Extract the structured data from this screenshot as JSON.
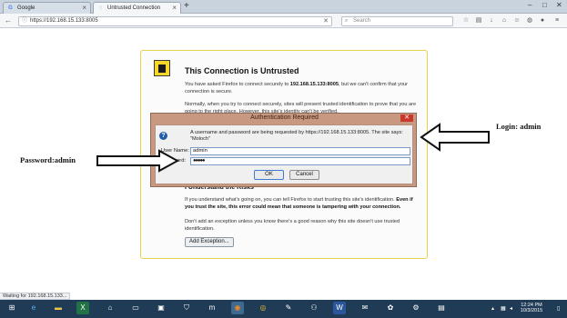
{
  "browser": {
    "tabs": [
      {
        "label": "Google",
        "favicon": "google-g-icon"
      },
      {
        "label": "Untrusted Connection",
        "favicon": "loading-spinner-icon"
      }
    ],
    "url": "https://192.168.15.133:8005",
    "search_placeholder": "Search"
  },
  "error_page": {
    "title": "This Connection is Untrusted",
    "p1_before": "You have asked Firefox to connect securely to ",
    "p1_host": "192.168.15.133:8005",
    "p1_after": ", but we can't confirm that your connection is secure.",
    "p2": "Normally, when you try to connect securely, sites will present trusted identification to prove that you are going to the right place. However, this site's identity can't be verified.",
    "risks_heading": "I Understand the Risks",
    "p3_before": "If you understand what's going on, you can tell Firefox to start trusting this site's identification. ",
    "p3_bold": "Even if you trust the site, this error could mean that someone is tampering with your connection.",
    "p4": "Don't add an exception unless you know there's a good reason why this site doesn't use trusted identification.",
    "add_exception_label": "Add Exception..."
  },
  "auth_dialog": {
    "title": "Authentication Required",
    "close_glyph": "✕",
    "message": "A username and password are being requested by https://192.168.15.133:8005. The site says: \"Moloch\"",
    "username_label": "User Name:",
    "username_value": "admin",
    "password_label": "Password:",
    "password_value": "●●●●●",
    "ok_label": "OK",
    "cancel_label": "Cancel"
  },
  "annotations": {
    "login": "Login: admin",
    "password": "Password:admin"
  },
  "status_bar": {
    "text": "Waiting for 192.168.15.133..."
  },
  "taskbar": {
    "time": "12:24 PM",
    "date": "10/3/2015",
    "apps": [
      "start-icon",
      "ie-icon",
      "file-explorer-icon",
      "excel-icon",
      "home-icon",
      "remote-desktop-icon",
      "network-icon",
      "shield-icon",
      "maxthon-icon",
      "firefox-icon",
      "chrome-icon",
      "tool-icon",
      "network-share-icon",
      "mail-icon",
      "word-icon",
      "paint-icon",
      "settings-icon",
      "notepad-icon"
    ]
  },
  "colors": {
    "dialog_frame": "#c89880",
    "error_border": "#e8d34b",
    "taskbar": "#1f3b55"
  }
}
